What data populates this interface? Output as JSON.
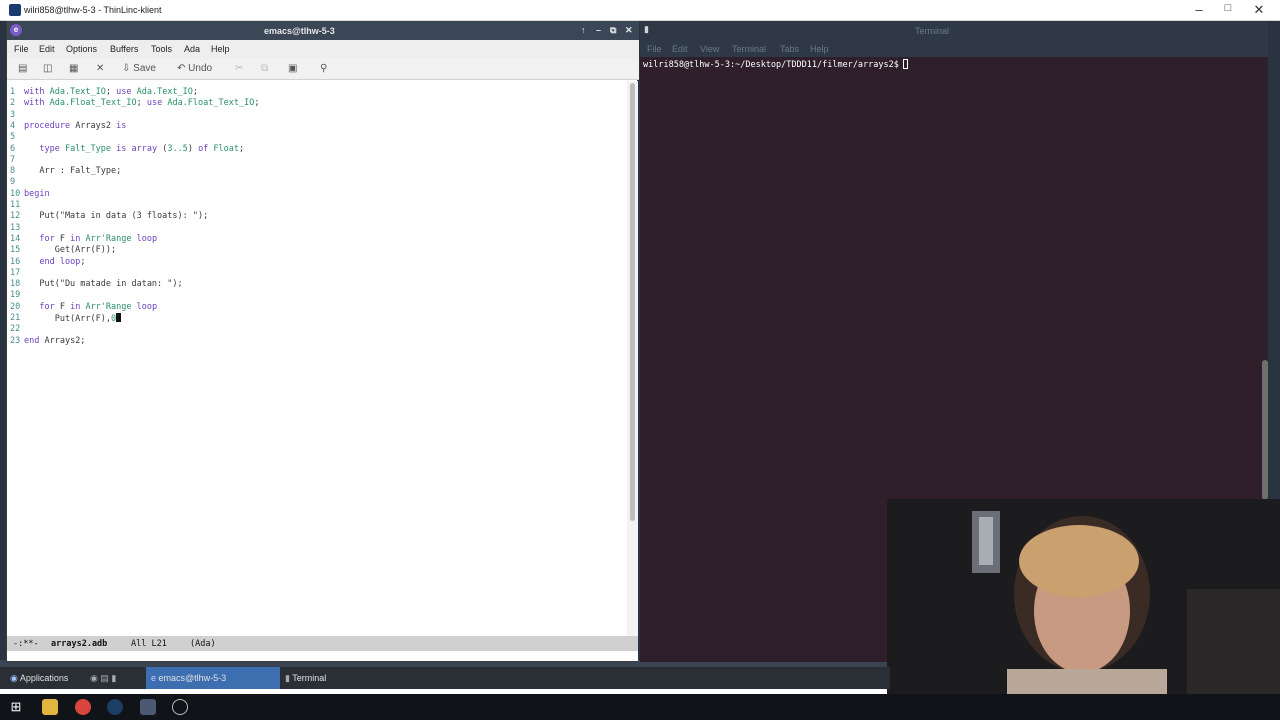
{
  "outer_window": {
    "title": "wilri858@tlhw-5-3 - ThinLinc-klient",
    "controls": [
      "minimize",
      "maximize",
      "close"
    ]
  },
  "emacs": {
    "title": "emacs@tlhw-5-3",
    "menu": [
      "File",
      "Edit",
      "Options",
      "Buffers",
      "Tools",
      "Ada",
      "Help"
    ],
    "toolbar": {
      "save_label": "Save",
      "undo_label": "Undo"
    },
    "lines": [
      {
        "n": "1",
        "segments": [
          [
            "kw",
            "with "
          ],
          [
            "ty",
            "Ada.Text_IO"
          ],
          [
            "st",
            "; "
          ],
          [
            "kw",
            "use "
          ],
          [
            "ty",
            "Ada.Text_IO"
          ],
          [
            "st",
            ";"
          ]
        ]
      },
      {
        "n": "2",
        "segments": [
          [
            "kw",
            "with "
          ],
          [
            "ty",
            "Ada.Float_Text_IO"
          ],
          [
            "st",
            "; "
          ],
          [
            "kw",
            "use "
          ],
          [
            "ty",
            "Ada.Float_Text_IO"
          ],
          [
            "st",
            ";"
          ]
        ]
      },
      {
        "n": "3",
        "segments": []
      },
      {
        "n": "4",
        "segments": [
          [
            "kw",
            "procedure "
          ],
          [
            "st",
            "Arrays2 "
          ],
          [
            "kw",
            "is"
          ]
        ]
      },
      {
        "n": "5",
        "segments": []
      },
      {
        "n": "6",
        "segments": [
          [
            "st",
            "   "
          ],
          [
            "kw",
            "type "
          ],
          [
            "ty",
            "Falt_Type "
          ],
          [
            "kw",
            "is array "
          ],
          [
            "st",
            "("
          ],
          [
            "ty",
            "3..5"
          ],
          [
            "st",
            ") "
          ],
          [
            "kw",
            "of "
          ],
          [
            "ty",
            "Float"
          ],
          [
            "st",
            ";"
          ]
        ]
      },
      {
        "n": "7",
        "segments": []
      },
      {
        "n": "8",
        "segments": [
          [
            "st",
            "   Arr : Falt_Type;"
          ]
        ]
      },
      {
        "n": "9",
        "segments": []
      },
      {
        "n": "10",
        "segments": [
          [
            "kw",
            "begin"
          ]
        ]
      },
      {
        "n": "11",
        "segments": []
      },
      {
        "n": "12",
        "segments": [
          [
            "st",
            "   Put(\"Mata in data (3 floats): \");"
          ]
        ]
      },
      {
        "n": "13",
        "segments": []
      },
      {
        "n": "14",
        "segments": [
          [
            "st",
            "   "
          ],
          [
            "kw",
            "for "
          ],
          [
            "st",
            "F "
          ],
          [
            "kw",
            "in "
          ],
          [
            "ty",
            "Arr'Range "
          ],
          [
            "kw",
            "loop"
          ]
        ]
      },
      {
        "n": "15",
        "segments": [
          [
            "st",
            "      Get(Arr(F));"
          ]
        ]
      },
      {
        "n": "16",
        "segments": [
          [
            "st",
            "   "
          ],
          [
            "kw",
            "end loop"
          ],
          [
            "st",
            ";"
          ]
        ]
      },
      {
        "n": "17",
        "segments": []
      },
      {
        "n": "18",
        "segments": [
          [
            "st",
            "   Put(\"Du matade in datan: \");"
          ]
        ]
      },
      {
        "n": "19",
        "segments": []
      },
      {
        "n": "20",
        "segments": [
          [
            "st",
            "   "
          ],
          [
            "kw",
            "for "
          ],
          [
            "st",
            "F "
          ],
          [
            "kw",
            "in "
          ],
          [
            "ty",
            "Arr'Range "
          ],
          [
            "kw",
            "loop"
          ]
        ]
      },
      {
        "n": "21",
        "segments": [
          [
            "st",
            "      Put(Arr(F),"
          ],
          [
            "ty",
            "0"
          ]
        ],
        "cursor": true
      },
      {
        "n": "22",
        "segments": []
      },
      {
        "n": "23",
        "segments": [
          [
            "kw",
            "end "
          ],
          [
            "st",
            "Arrays2;"
          ]
        ]
      }
    ],
    "modeline": {
      "status": "-:**-",
      "buffer": "arrays2.adb",
      "position": "All L21",
      "mode": "(Ada)"
    }
  },
  "terminal": {
    "title": "Terminal",
    "menu": [
      "File",
      "Edit",
      "View",
      "Terminal",
      "Tabs",
      "Help"
    ],
    "prompt": "wilri858@tlhw-5-3:~/Desktop/TDDD11/filmer/arrays2$"
  },
  "panel": {
    "applications_label": "Applications",
    "tasks": [
      {
        "label": "emacs@tlhw-5-3",
        "active": true
      },
      {
        "label": "Terminal",
        "active": false
      }
    ]
  },
  "colors": {
    "accent": "#3d6fb0",
    "terminal_bg": "#2e1f2b",
    "keyword": "#6c3fbf",
    "type": "#2a8f6a"
  }
}
